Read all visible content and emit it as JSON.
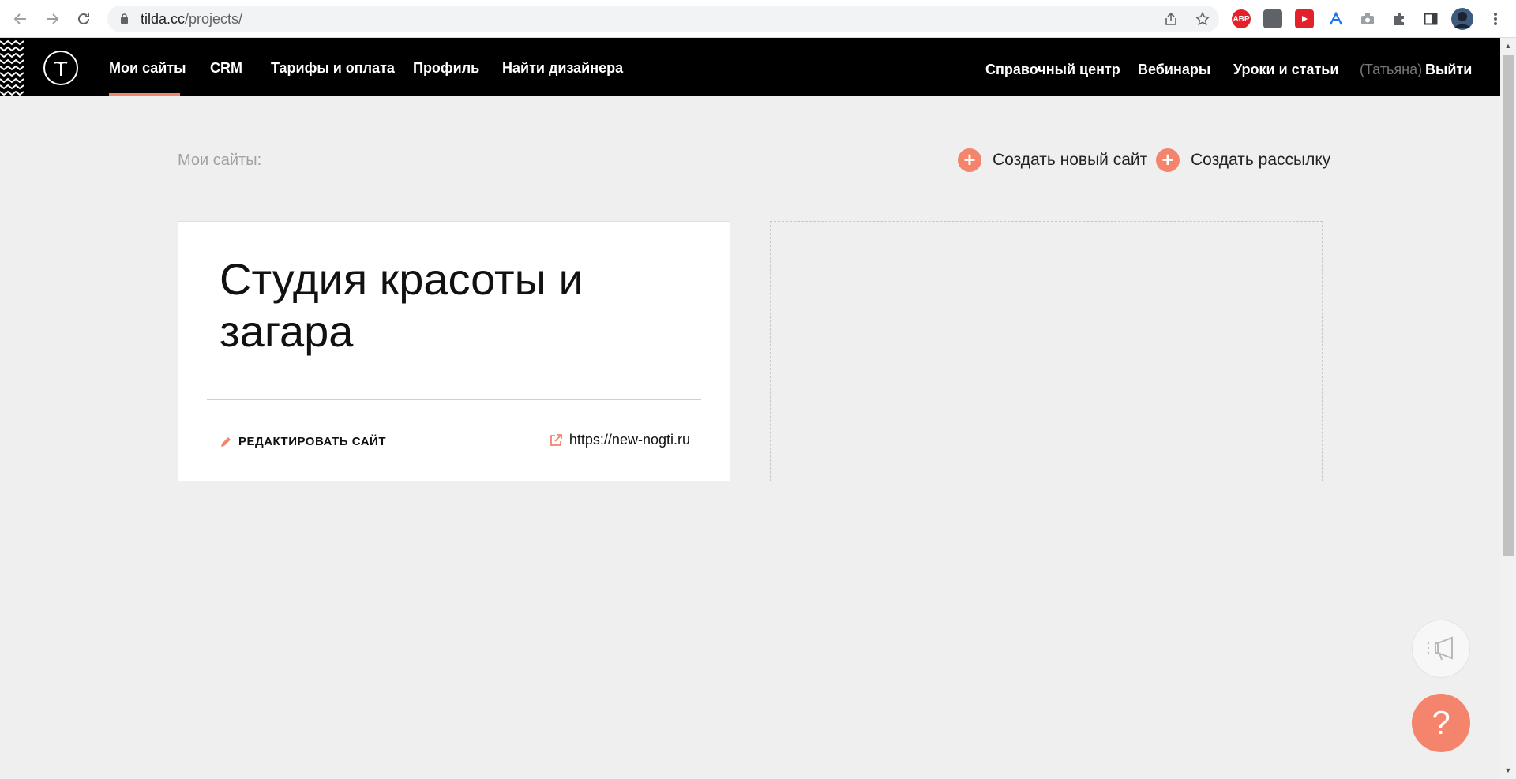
{
  "browser": {
    "url_host": "tilda.cc",
    "url_path": "/projects/",
    "extensions": [
      {
        "name": "adblock-icon",
        "label": "ABP",
        "color": "#e4202b"
      },
      {
        "name": "extension-dark-icon",
        "label": "",
        "color": "#5f6368"
      },
      {
        "name": "youtube-icon",
        "label": "",
        "color": "#e4202b"
      },
      {
        "name": "acrobat-icon",
        "label": "",
        "color": "#1a73e8"
      },
      {
        "name": "camera-icon",
        "label": "",
        "color": "#9aa0a6"
      },
      {
        "name": "puzzle-icon",
        "label": "",
        "color": "#5f6368"
      },
      {
        "name": "side-panel-icon",
        "label": "",
        "color": "#3c4043"
      }
    ]
  },
  "header": {
    "nav_left": [
      "Мои сайты",
      "CRM",
      "Тарифы и оплата",
      "Профиль",
      "Найти дизайнера"
    ],
    "nav_right": [
      "Справочный центр",
      "Вебинары",
      "Уроки и статьи"
    ],
    "user_name": "(Татьяна)",
    "logout": "Выйти",
    "accent": "#f4846b"
  },
  "main": {
    "label": "Мои сайты:",
    "create_site": "Создать новый сайт",
    "create_mailing": "Создать рассылку",
    "projects": [
      {
        "title": "Студия красоты и загара",
        "edit_label": "РЕДАКТИРОВАТЬ САЙТ",
        "link": "https://new-nogti.ru"
      }
    ]
  },
  "help_button": "?"
}
